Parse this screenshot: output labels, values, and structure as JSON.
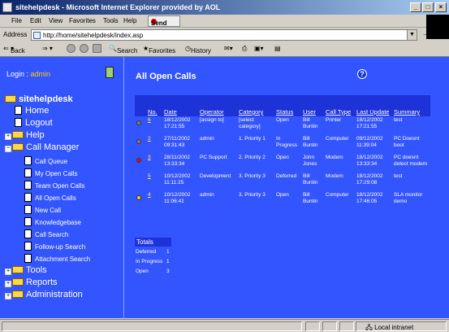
{
  "window": {
    "title": "sitehelpdesk - Microsoft Internet Explorer provided by AOL"
  },
  "menubar": {
    "items": [
      "File",
      "Edit",
      "View",
      "Favorites",
      "Tools",
      "Help"
    ],
    "send_label": "Send"
  },
  "address": {
    "label": "Address",
    "url": "http://home/sitehelpdesk/index.asp",
    "go_label": "Go"
  },
  "toolbar": {
    "back_label": "Back",
    "search_label": "Search",
    "favorites_label": "Favorites",
    "history_label": "History"
  },
  "login": {
    "label": "Login : ",
    "user": "admin"
  },
  "nav": {
    "root": "sitehelpdesk",
    "home": "Home",
    "logout": "Logout",
    "help": "Help",
    "call_manager": "Call Manager",
    "call_manager_items": [
      "Call Queue",
      "My Open Calls",
      "Team Open Calls",
      "All Open Calls",
      "New Call",
      "Knowledgebase",
      "Call Search",
      "Follow-up Search",
      "Attachment Search"
    ],
    "tools": "Tools",
    "reports": "Reports",
    "administration": "Administration"
  },
  "main": {
    "title": "All Open Calls",
    "help_glyph": "?",
    "columns": [
      "No.",
      "Date",
      "Operator",
      "Category",
      "Status",
      "User",
      "Call Type",
      "Last Update",
      "Summary"
    ],
    "rows": [
      {
        "dot": "#808080",
        "no": "6",
        "date": "18/12/2002 17:21:55",
        "operator": "[assign to]",
        "category": "[select category]",
        "status": "Open",
        "user": "Bill Buntin",
        "type": "Printer",
        "updated": "18/12/2002 17:21:55",
        "summary": "test"
      },
      {
        "dot": "#808080",
        "no": "2",
        "date": "27/11/2002 09:31:43",
        "operator": "admin",
        "category": "1. Priority 1",
        "status": "In Progress",
        "user": "Bill Buntin",
        "type": "Computer",
        "updated": "09/12/2002 11:39:04",
        "summary": "PC Doesnt boot"
      },
      {
        "dot": "#ff0000",
        "no": "3",
        "date": "28/11/2002 13:33:34",
        "operator": "PC Support",
        "category": "2. Priority 2",
        "status": "Open",
        "user": "John Jones",
        "type": "Modem",
        "updated": "18/12/2002 13:33:34",
        "summary": "PC doesnt detect modem"
      },
      {
        "dot": "",
        "no": "5",
        "date": "10/12/2002 11:11:25",
        "operator": "Development",
        "category": "3. Priority 3",
        "status": "Deferred",
        "user": "Bill Buntin",
        "type": "Modem",
        "updated": "18/12/2002 17:29:08",
        "summary": "test"
      },
      {
        "dot": "#ffcc00",
        "no": "4",
        "date": "10/12/2002 11:06:41",
        "operator": "admin",
        "category": "3. Priority 3",
        "status": "Open",
        "user": "Bill Buntin",
        "type": "Computer",
        "updated": "18/12/2002 17:46:05",
        "summary": "SLA monitor demo"
      }
    ],
    "totals": {
      "title": "Totals",
      "rows": [
        {
          "label": "Deferred",
          "count": "1"
        },
        {
          "label": "In Progress",
          "count": "1"
        },
        {
          "label": "Open",
          "count": "3"
        }
      ]
    }
  },
  "statusbar": {
    "zone": "Local intranet"
  }
}
